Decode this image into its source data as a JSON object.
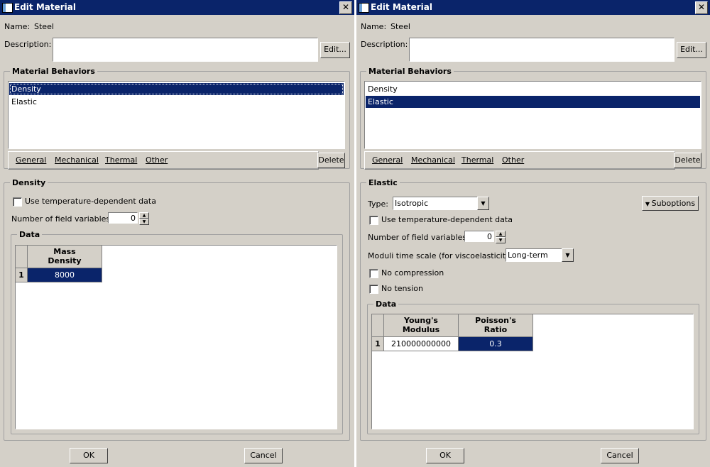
{
  "left": {
    "title": "Edit Material",
    "close": "✕",
    "name_label": "Name:",
    "name_value": "Steel",
    "description_label": "Description:",
    "description_value": "",
    "edit_button": "Edit...",
    "behaviors_title": "Material Behaviors",
    "behaviors": [
      {
        "label": "Density",
        "selected": true
      },
      {
        "label": "Elastic",
        "selected": false
      }
    ],
    "menus": [
      "General",
      "Mechanical",
      "Thermal",
      "Other"
    ],
    "delete_button": "Delete",
    "section_title": "Density",
    "use_temp_label": "Use temperature-dependent data",
    "use_temp_checked": false,
    "field_vars_label": "Number of field variables:",
    "field_vars_value": "0",
    "data_title": "Data",
    "table": {
      "columns": [
        "Mass\nDensity"
      ],
      "rows": [
        {
          "index": "1",
          "cells": [
            "8000"
          ]
        }
      ]
    },
    "ok_button": "OK",
    "cancel_button": "Cancel"
  },
  "right": {
    "title": "Edit Material",
    "close": "✕",
    "name_label": "Name:",
    "name_value": "Steel",
    "description_label": "Description:",
    "description_value": "",
    "edit_button": "Edit...",
    "behaviors_title": "Material Behaviors",
    "behaviors": [
      {
        "label": "Density",
        "selected": false
      },
      {
        "label": "Elastic",
        "selected": true
      }
    ],
    "menus": [
      "General",
      "Mechanical",
      "Thermal",
      "Other"
    ],
    "delete_button": "Delete",
    "section_title": "Elastic",
    "type_label": "Type:",
    "type_value": "Isotropic",
    "suboptions_button": "Suboptions",
    "use_temp_label": "Use temperature-dependent data",
    "field_vars_label": "Number of field variables:",
    "field_vars_value": "0",
    "moduli_label": "Moduli time scale (for viscoelasticity):",
    "moduli_value": "Long-term",
    "no_compression_label": "No compression",
    "no_tension_label": "No tension",
    "data_title": "Data",
    "table": {
      "columns": [
        "Young's\nModulus",
        "Poisson's\nRatio"
      ],
      "rows": [
        {
          "index": "1",
          "cells": [
            "210000000000",
            "0.3"
          ]
        }
      ]
    },
    "ok_button": "OK",
    "cancel_button": "Cancel"
  },
  "colors": {
    "title_bar": "#0a246a",
    "dialog_bg": "#d4d0c8",
    "selection": "#0a246a"
  }
}
